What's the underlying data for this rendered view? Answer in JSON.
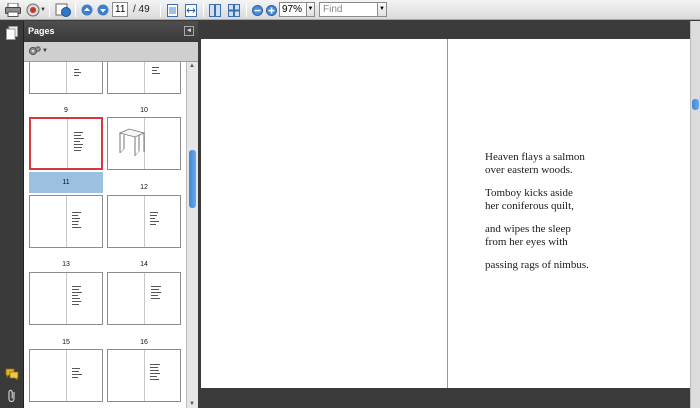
{
  "toolbar": {
    "current_page": "11",
    "page_total": "/ 49",
    "zoom": "97%",
    "find_placeholder": "Find"
  },
  "panel": {
    "title": "Pages"
  },
  "thumbnails": [
    {
      "page": "9"
    },
    {
      "page": "10"
    },
    {
      "page": "11"
    },
    {
      "page": "12"
    },
    {
      "page": "13"
    },
    {
      "page": "14"
    },
    {
      "page": "15"
    },
    {
      "page": "16"
    }
  ],
  "poem": {
    "stanza1": [
      "Heaven flays a salmon",
      "over eastern woods."
    ],
    "stanza2": [
      "Tomboy kicks aside",
      "her coniferous quilt,"
    ],
    "stanza3": [
      "and wipes the sleep",
      "from her eyes with"
    ],
    "stanza4": [
      "passing rags of nimbus."
    ]
  },
  "colors": {
    "selection_highlight": "#9cc0df",
    "selected_border": "#d43a3a",
    "scroll_thumb": "#3e87d8"
  }
}
